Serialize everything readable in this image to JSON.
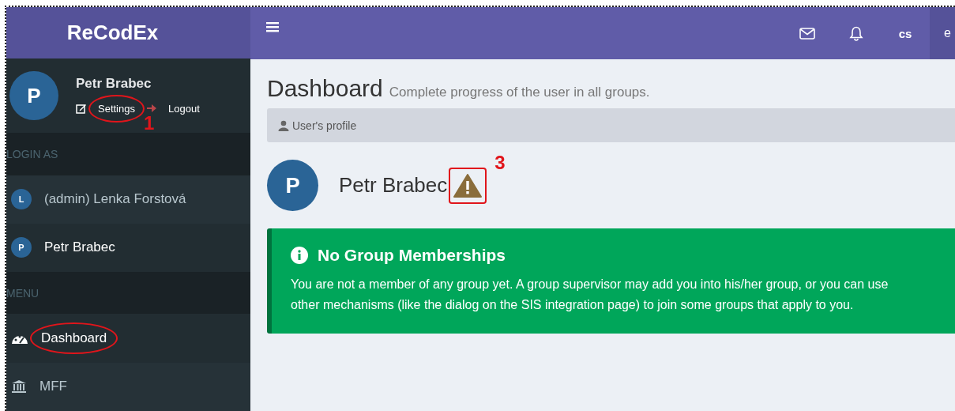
{
  "brand": "ReCodEx",
  "user_panel": {
    "avatar": "P",
    "name": "Petr Brabec",
    "links": [
      {
        "kind": "settings",
        "label": "Settings",
        "annotation": {
          "kind": "ellipse",
          "number": "1"
        }
      },
      {
        "kind": "logout",
        "label": "Logout"
      }
    ]
  },
  "sidebar": {
    "sections": [
      {
        "header": "LOGIN AS",
        "items": [
          {
            "kind": "user",
            "avatar": "L",
            "label": "(admin) Lenka Forstová",
            "selected": false
          },
          {
            "kind": "user",
            "avatar": "P",
            "label": "Petr Brabec",
            "selected": true
          }
        ]
      },
      {
        "header": "MENU",
        "items": [
          {
            "kind": "dashboard",
            "label": "Dashboard",
            "selected": true,
            "annotation": {
              "kind": "ellipse"
            }
          },
          {
            "kind": "institution",
            "label": "MFF",
            "selected": false
          }
        ]
      }
    ]
  },
  "topbar": {
    "language": "cs",
    "cut_item": "e"
  },
  "page": {
    "title": "Dashboard",
    "subtitle": "Complete progress of the user in all groups.",
    "breadcrumb": "User's profile",
    "profile": {
      "avatar": "P",
      "name": "Petr Brabec",
      "warning": true,
      "annotation": {
        "kind": "rectangle",
        "number": "3"
      }
    },
    "callout": {
      "title": "No Group Memberships",
      "text": "You are not a member of any group yet. A group supervisor may add you into his/her group, or you can use other mechanisms (like the dialog on the SIS integration page) to join some groups that apply to you."
    }
  }
}
